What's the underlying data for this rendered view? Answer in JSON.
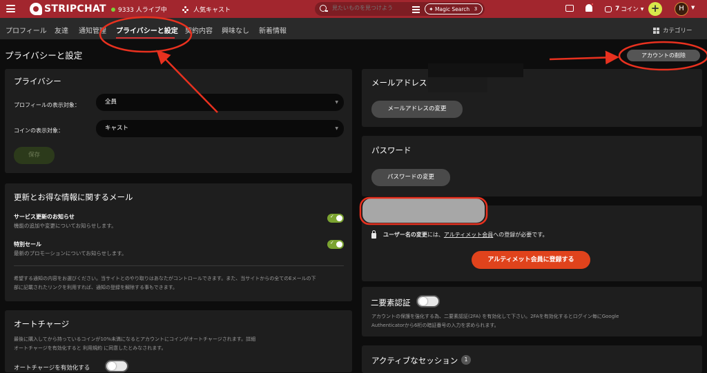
{
  "header": {
    "logo": "STRIPCHAT",
    "live_count": "9333 人ライブ中",
    "popular": "人気キャスト",
    "search_placeholder": "見たいものを見つけよう",
    "magic_label": "Magic Search",
    "magic_count": "3",
    "coins_num": "7",
    "coins_label": "コイン",
    "plus": "+",
    "avatar": "H",
    "accent": "#a2262e"
  },
  "subnav": {
    "items": [
      "プロフィール",
      "友達",
      "通知管理",
      "プライバシーと設定",
      "契約内容",
      "興味なし",
      "新着情報"
    ],
    "category": "カテゴリー"
  },
  "page": {
    "title": "プライバシーと設定",
    "delete_button": "アカウントの削除"
  },
  "privacy": {
    "title": "プライバシー",
    "profile_label": "プロフィールの表示対象：",
    "profile_value": "全員",
    "coins_label": "コインの表示対象：",
    "coins_value": "キャスト",
    "save": "保存"
  },
  "mail": {
    "title": "更新とお得な情報に関するメール",
    "service_title": "サービス更新のお知らせ",
    "service_sub": "機能の追加や変更についてお知らせします。",
    "sale_title": "特別セール",
    "sale_sub": "最新のプロモーションについてお知らせします。",
    "note_line1": "希望する通知の内容をお選びください。当サイトとのやり取りはあなたがコントロールできます。また、当サイトからの全てのEメールの下",
    "note_line2": "部に記載されたリンクを利用すれば、通知の登録を解除する事もできます。"
  },
  "autocharge": {
    "title": "オートチャージ",
    "note_line1": "最後に購入してから持っているコインが10%未満になるとアカウントにコインがオートチャージされます。詳細",
    "note_line2": "オートチャージを有効化すると 利用規約 に同意したとみなされます。",
    "toggle_label": "オートチャージを有効化する"
  },
  "email": {
    "title": "メールアドレス",
    "change_button": "メールアドレスの変更"
  },
  "password": {
    "title": "パスワード",
    "change_button": "パスワードの変更"
  },
  "username": {
    "lock_bold": "ユーザー名の変更",
    "lock_mid": "には、",
    "lock_link": "アルティメット会員",
    "lock_end": "への登録が必要です。",
    "register_button": "アルティメット会員に登録する"
  },
  "twofa": {
    "title": "二要素認証",
    "note_line1": "アカウントの保護を強化する為、二要素認証(2FA) を有効化して下さい。2FAを有効化するとログイン毎にGoogle",
    "note_line2": "Authenticatorから6桁の暗証番号の入力を求められます。"
  },
  "sessions": {
    "title": "アクティブなセッション",
    "count": "1"
  }
}
